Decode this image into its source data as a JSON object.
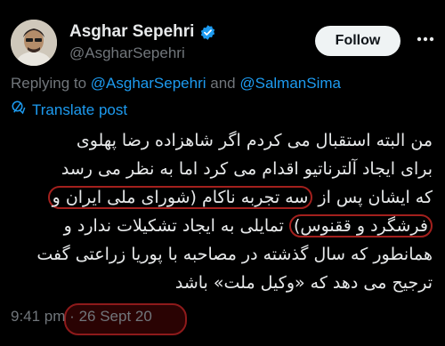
{
  "author": {
    "display_name": "Asghar Sepehri",
    "handle": "@AsgharSepehri"
  },
  "follow_label": "Follow",
  "reply": {
    "prefix": "Replying to",
    "mention_1": "@AsgharSepehri",
    "conjunction": "and",
    "mention_2": "@SalmanSima"
  },
  "translate_label": "Translate post",
  "post": {
    "line1": "من البته استقبال می کردم اگر شاهزاده رضا پهلوی",
    "line2": "برای ایجاد آلترناتیو اقدام می کرد اما به نظر می رسد",
    "line3_pre": "که ایشان پس از ",
    "line3_hl": "سه تجربه ناکام (شورای ملی ایران و",
    "line4_hl": "فرشگرد و ققنوس)",
    "line4_post": " تمایلی به ایجاد تشکیلات ندارد و",
    "line5": "همانطور که سال گذشته در مصاحبه با پوریا زراعتی گفت",
    "line6": "ترجیح می دهد که «وکیل ملت» باشد"
  },
  "meta": {
    "time": "9:41 pm",
    "separator": "·",
    "date": "26 Sept 20"
  },
  "colors": {
    "background": "#000000",
    "link": "#1d9bf0",
    "secondary": "#71767b",
    "highlight_ring": "#a3201d"
  }
}
